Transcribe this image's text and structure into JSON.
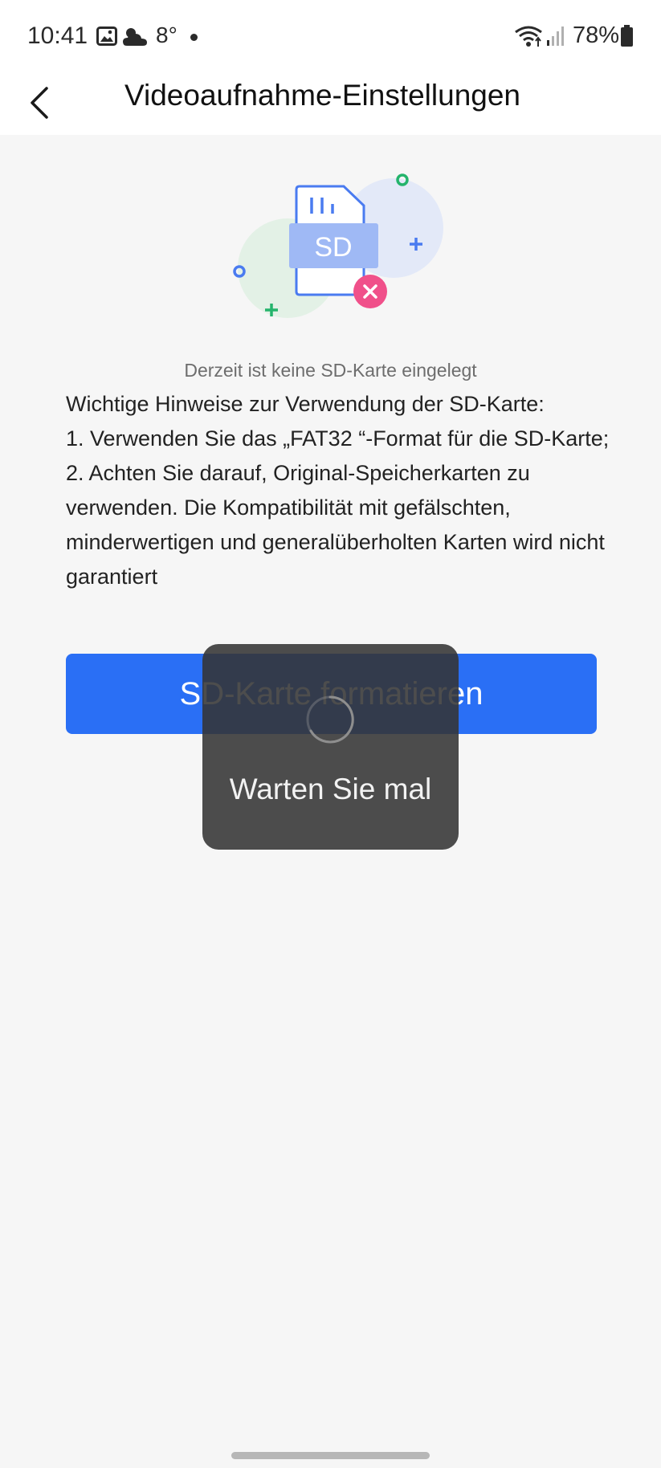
{
  "status_bar": {
    "time": "10:41",
    "temperature": "8°",
    "battery": "78%"
  },
  "header": {
    "title": "Videoaufnahme-Einstellungen"
  },
  "illustration": {
    "card_label": "SD"
  },
  "content": {
    "status": "Derzeit ist keine SD-Karte eingelegt",
    "notes": [
      "Wichtige Hinweise zur Verwendung der SD-Karte:",
      "1. Verwenden Sie das „FAT32 “-Format für die SD-Karte;",
      "2. Achten Sie darauf, Original-Speicherkarten zu verwenden. Die Kompatibilität mit gefälschten, minderwertigen und generalüberholten Karten wird nicht garantiert"
    ],
    "format_button": "SD-Karte formatieren"
  },
  "loading": {
    "text": "Warten Sie mal"
  },
  "colors": {
    "accent": "#2a6ff5",
    "overlay": "#343434",
    "error": "#f0508a"
  }
}
